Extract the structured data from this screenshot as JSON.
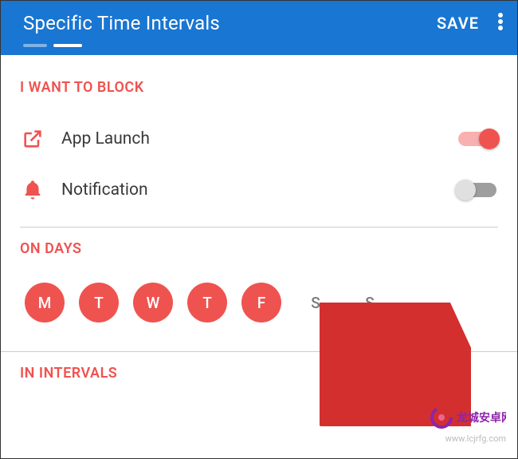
{
  "appbar": {
    "title": "Specific Time Intervals",
    "save": "SAVE"
  },
  "sections": {
    "block": "I WANT TO BLOCK",
    "days": "ON DAYS",
    "intervals": "IN INTERVALS"
  },
  "block_items": {
    "app_launch": {
      "label": "App Launch",
      "on": true
    },
    "notification": {
      "label": "Notification",
      "on": false
    }
  },
  "days": [
    {
      "letter": "M",
      "selected": true
    },
    {
      "letter": "T",
      "selected": true
    },
    {
      "letter": "W",
      "selected": true
    },
    {
      "letter": "T",
      "selected": true
    },
    {
      "letter": "F",
      "selected": true
    },
    {
      "letter": "S",
      "selected": false
    },
    {
      "letter": "S",
      "selected": false
    }
  ],
  "watermark": {
    "site_name": "龙城安卓网",
    "url": "www.lcjrfg.com"
  },
  "colors": {
    "primary": "#1976d2",
    "accent": "#ef5350"
  }
}
